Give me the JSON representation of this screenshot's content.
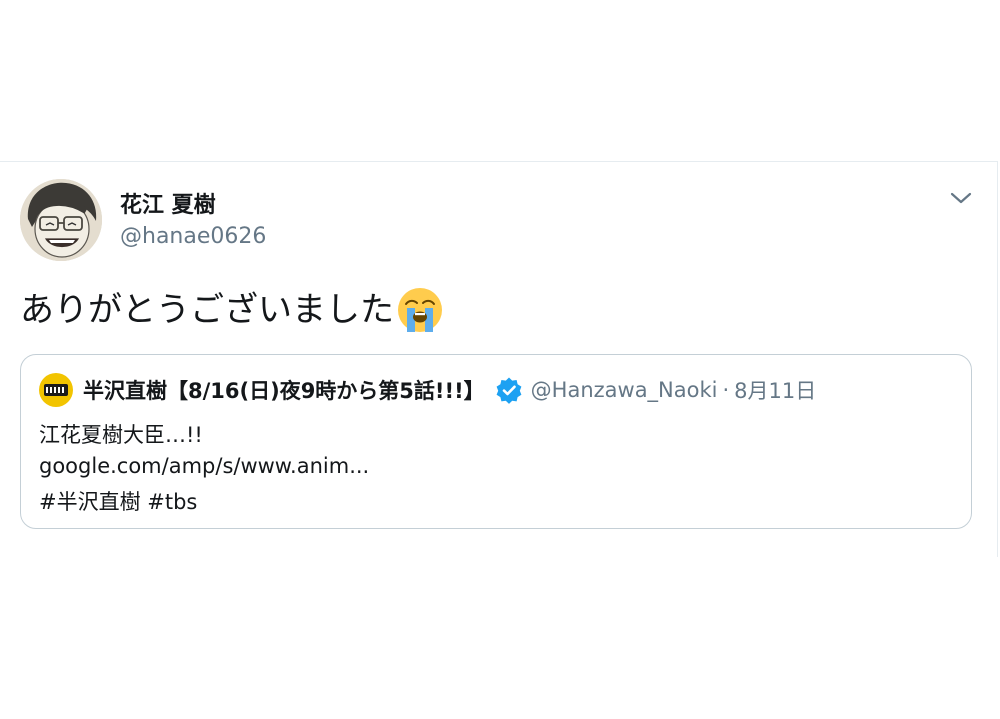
{
  "tweet": {
    "author": {
      "name": "花江 夏樹",
      "handle": "@hanae0626"
    },
    "text": "ありがとうございました",
    "emoji_icon": "loudly-crying-face-emoji",
    "quoted": {
      "avatar_icon": "hanzawa-logo-icon",
      "name": "半沢直樹【8/16(日)夜9時から第5話!!!】",
      "verified_icon": "verified-badge-icon",
      "handle": "@Hanzawa_Naoki",
      "separator": "·",
      "date": "8月11日",
      "lines": [
        "江花夏樹大臣…!!",
        "google.com/amp/s/www.anim...",
        "#半沢直樹 #tbs"
      ]
    }
  },
  "colors": {
    "text_primary": "#14171a",
    "text_secondary": "#657786",
    "verified_blue": "#1da1f2",
    "border": "#c4cfd6",
    "emoji_yellow": "#ffcc4d",
    "emoji_tears": "#5dadec"
  }
}
